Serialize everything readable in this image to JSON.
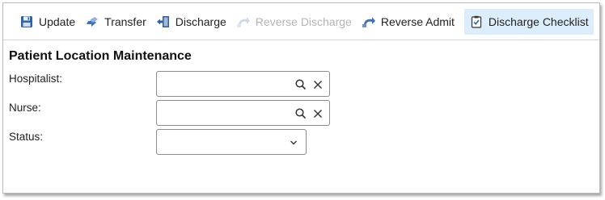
{
  "toolbar": {
    "buttons": [
      {
        "label": "Update",
        "icon": "floppy-disk-icon",
        "state": "enabled"
      },
      {
        "label": "Transfer",
        "icon": "transfer-icon",
        "state": "enabled"
      },
      {
        "label": "Discharge",
        "icon": "discharge-door-icon",
        "state": "enabled"
      },
      {
        "label": "Reverse Discharge",
        "icon": "reverse-arrow-icon",
        "state": "disabled"
      },
      {
        "label": "Reverse Admit",
        "icon": "reverse-arrow-icon",
        "state": "enabled"
      },
      {
        "label": "Discharge Checklist",
        "icon": "checklist-icon",
        "state": "highlighted"
      }
    ]
  },
  "form": {
    "title": "Patient Location Maintenance",
    "hospitalist": {
      "label": "Hospitalist:",
      "value": ""
    },
    "nurse": {
      "label": "Nurse:",
      "value": ""
    },
    "status": {
      "label": "Status:",
      "value": ""
    }
  },
  "colors": {
    "accent_blue": "#2f63a8",
    "highlight": "#dceefb",
    "disabled_text": "#b4b4b4"
  }
}
